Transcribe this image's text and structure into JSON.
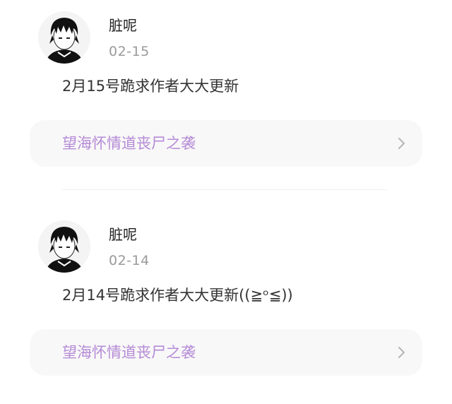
{
  "posts": [
    {
      "username": "脏呢",
      "date": "02-15",
      "content": "2月15号跪求作者大大更新",
      "book_title": "望海怀情道丧尸之袭"
    },
    {
      "username": "脏呢",
      "date": "02-14",
      "content": "2月14号跪求作者大大更新((≧ᵒ≦))",
      "book_title": "望海怀情道丧尸之袭"
    }
  ],
  "colors": {
    "book_title": "#b58ad6",
    "card_background": "#f8f8f8",
    "date_text": "#9a9a9a"
  },
  "icons": {
    "avatar": "anime-character-avatar",
    "chevron": "chevron-right-icon"
  }
}
